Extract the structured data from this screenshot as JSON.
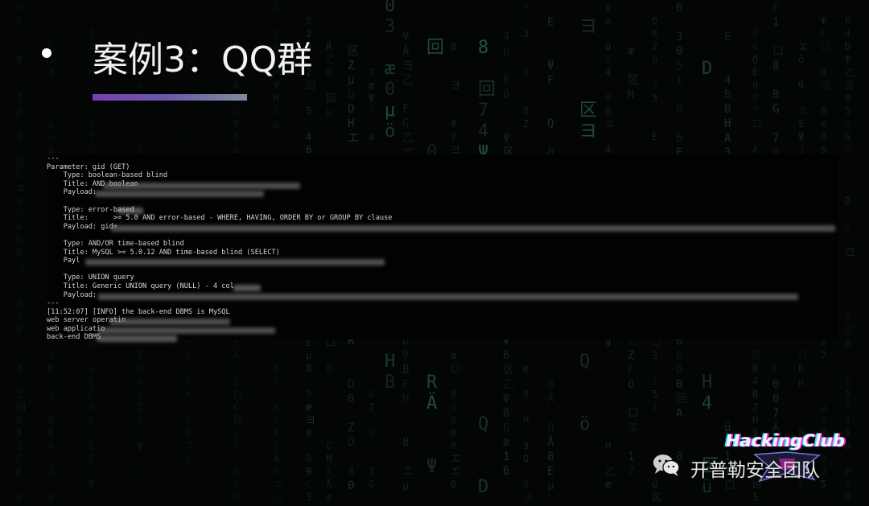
{
  "slide": {
    "title": "案例3：QQ群",
    "accent_gradient": [
      "#7a3fb2",
      "#7f8d9a"
    ],
    "background_color": "#030605"
  },
  "terminal": {
    "lines": [
      "---",
      "Parameter: gid (GET)",
      "    Type: boolean-based blind",
      "    Title: AND boolean",
      "    Payload:",
      "",
      "    Type: error-based",
      "    Title:      >= 5.0 AND error-based - WHERE, HAVING, ORDER BY or GROUP BY clause",
      "    Payload: gid=",
      "",
      "    Type: AND/OR time-based blind",
      "    Title: MySQL >= 5.0.12 AND time-based blind (SELECT)",
      "    Payl",
      "",
      "    Type: UNION query",
      "    Title: Generic UNION query (NULL) - 4 col",
      "    Payload:",
      "---",
      "[11:52:07] [INFO] the back-end DBMS is MySQL",
      "web server operatin",
      "web applicatio",
      "back-end DBMS"
    ]
  },
  "watermark": {
    "icon": "wechat-icon",
    "text": "开普勒安全团队",
    "logo_text": "HackingClub"
  },
  "matrix_glyphs": {
    "col1": "口7回エ4ö0ヨ区",
    "col2": "ZG乙4ヨ0エ",
    "col3": "ロ9ÈR口6エ",
    "col4": "æ6ÄSo2ü",
    "col5": "ΨμΘ6Ä口",
    "col6": "E口区ヨ4"
  }
}
